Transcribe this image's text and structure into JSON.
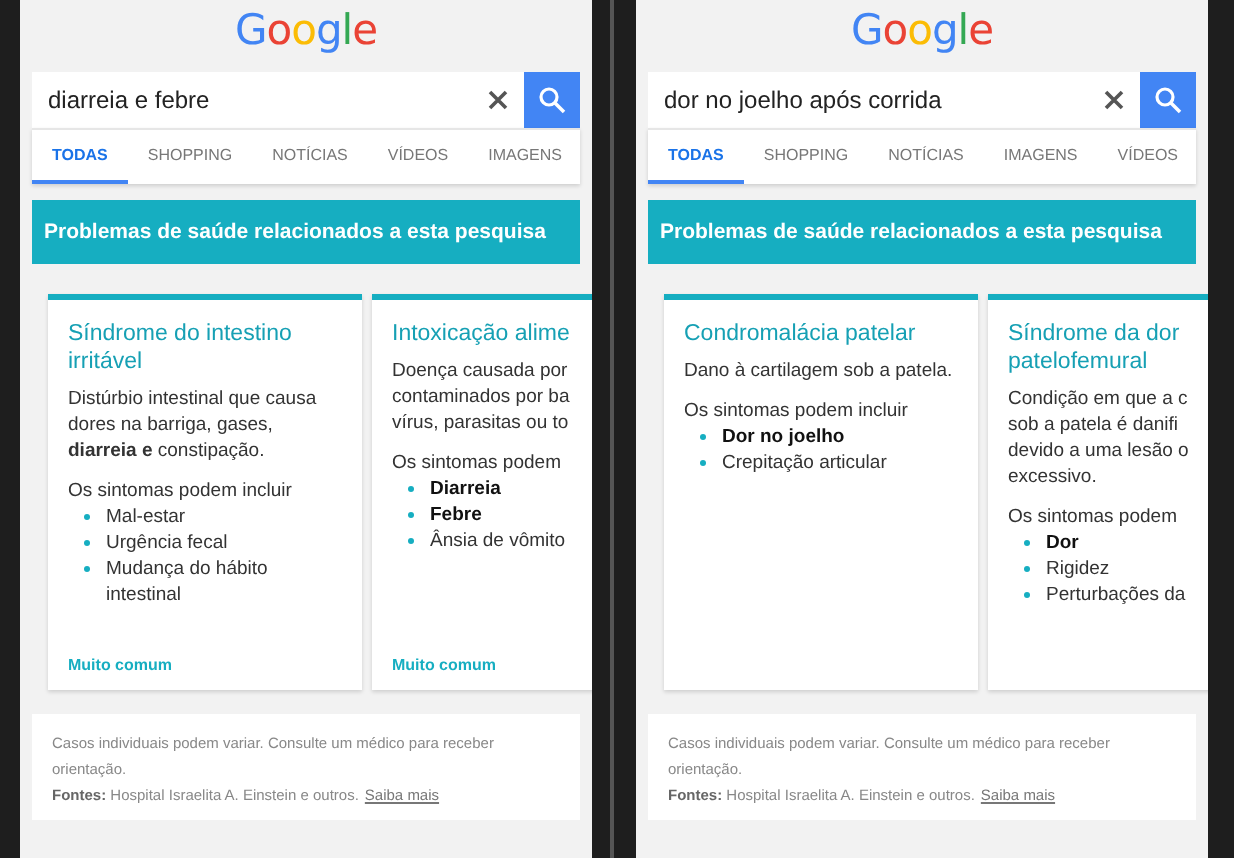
{
  "phones": [
    {
      "logo": "Google",
      "query": "diarreia e febre",
      "tabs": [
        {
          "label": "TODAS",
          "selected": true
        },
        {
          "label": "SHOPPING",
          "selected": false
        },
        {
          "label": "NOTÍCIAS",
          "selected": false
        },
        {
          "label": "VÍDEOS",
          "selected": false
        },
        {
          "label": "IMAGENS",
          "selected": false
        }
      ],
      "banner": "Problemas de saúde relacionados a esta pesquisa",
      "cards": [
        {
          "title": [
            "Síndrome do intestino",
            "irritável"
          ],
          "description": [
            "Distúrbio intestinal que causa",
            "dores na barriga, gases,",
            "**diarreia e** constipação."
          ],
          "symptoms_heading": "Os sintomas podem incluir",
          "symptoms": [
            {
              "text": "Mal-estar",
              "bold": false
            },
            {
              "text": "Urgência fecal",
              "bold": false
            },
            {
              "text": "Mudança do hábito intestinal",
              "bold": false
            }
          ],
          "frequency": "Muito comum"
        },
        {
          "title": [
            "Intoxicação alime"
          ],
          "description": [
            "Doença causada por",
            "contaminados por ba",
            "vírus, parasitas ou to"
          ],
          "symptoms_heading": "Os sintomas podem",
          "symptoms": [
            {
              "text": "Diarreia",
              "bold": true
            },
            {
              "text": "Febre",
              "bold": true
            },
            {
              "text": "Ânsia de vômito",
              "bold": false
            }
          ],
          "frequency": "Muito comum"
        }
      ],
      "footer": {
        "note": "Casos individuais podem variar. Consulte um médico para receber orientação.",
        "sources": "**Fontes:** Hospital Israelita A. Einstein e outros.",
        "link": "Saiba mais"
      }
    },
    {
      "logo": "Google",
      "query": "dor no joelho após corrida",
      "tabs": [
        {
          "label": "TODAS",
          "selected": true
        },
        {
          "label": "SHOPPING",
          "selected": false
        },
        {
          "label": "NOTÍCIAS",
          "selected": false
        },
        {
          "label": "IMAGENS",
          "selected": false
        },
        {
          "label": "VÍDEOS",
          "selected": false
        }
      ],
      "banner": "Problemas de saúde relacionados a esta pesquisa",
      "cards": [
        {
          "title": [
            "Condromalácia patelar"
          ],
          "description": [
            "Dano à cartilagem sob a patela."
          ],
          "symptoms_heading": "Os sintomas podem incluir",
          "symptoms": [
            {
              "text": "Dor no joelho",
              "bold": true
            },
            {
              "text": "Crepitação articular",
              "bold": false
            }
          ]
        },
        {
          "title": [
            "Síndrome da dor",
            "patelofemural"
          ],
          "description": [
            "Condição em que a c",
            "sob a patela é danifi",
            "devido a uma lesão o",
            "excessivo."
          ],
          "symptoms_heading": "Os sintomas podem",
          "symptoms": [
            {
              "text": "Dor",
              "bold": true
            },
            {
              "text": "Rigidez",
              "bold": false
            },
            {
              "text": "Perturbações da",
              "bold": false
            }
          ]
        }
      ],
      "footer": {
        "note": "Casos individuais podem variar. Consulte um médico para receber orientação.",
        "sources": "**Fontes:** Hospital Israelita A. Einstein e outros.",
        "link": "Saiba mais"
      }
    }
  ]
}
